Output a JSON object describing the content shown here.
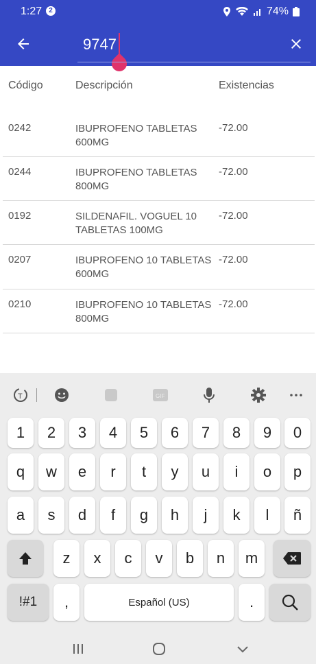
{
  "status_bar": {
    "time": "1:27",
    "notification_count": "2",
    "battery": "74%"
  },
  "search": {
    "value": "9747"
  },
  "table": {
    "headers": {
      "code": "Código",
      "description": "Descripción",
      "stock": "Existencias"
    },
    "rows": [
      {
        "code": "0242",
        "description": "IBUPROFENO TABLETAS 600MG",
        "stock": "-72.00"
      },
      {
        "code": "0244",
        "description": "IBUPROFENO TABLETAS 800MG",
        "stock": "-72.00"
      },
      {
        "code": "0192",
        "description": "SILDENAFIL. VOGUEL 10 TABLETAS 100MG",
        "stock": "-72.00"
      },
      {
        "code": "0207",
        "description": "IBUPROFENO 10 TABLETAS 600MG",
        "stock": "-72.00"
      },
      {
        "code": "0210",
        "description": "IBUPROFENO 10 TABLETAS 800MG",
        "stock": "-72.00"
      }
    ]
  },
  "keyboard": {
    "row_numbers": [
      "1",
      "2",
      "3",
      "4",
      "5",
      "6",
      "7",
      "8",
      "9",
      "0"
    ],
    "row_q": [
      "q",
      "w",
      "e",
      "r",
      "t",
      "y",
      "u",
      "i",
      "o",
      "p"
    ],
    "row_a": [
      "a",
      "s",
      "d",
      "f",
      "g",
      "h",
      "j",
      "k",
      "l",
      "ñ"
    ],
    "row_z": [
      "z",
      "x",
      "c",
      "v",
      "b",
      "n",
      "m"
    ],
    "symbols_label": "!#1",
    "comma_label": ",",
    "space_label": "Español (US)",
    "period_label": "."
  },
  "colors": {
    "app_bar": "#3548c4",
    "cursor": "#e0336b",
    "keyboard_bg": "#ededed"
  }
}
